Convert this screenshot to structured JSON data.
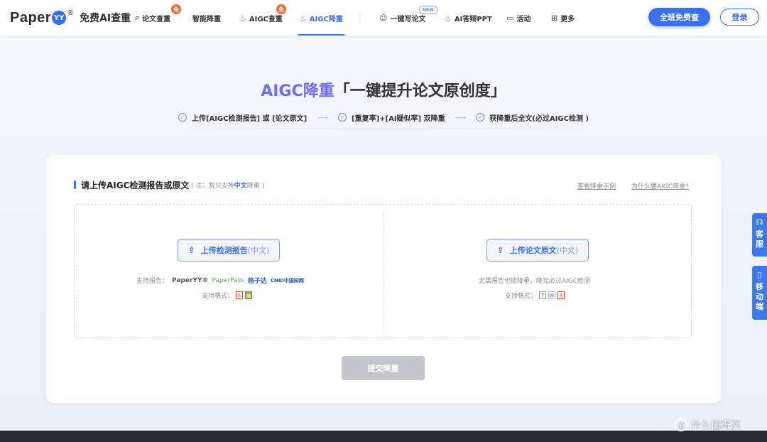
{
  "brand": {
    "logo_text": "Paper",
    "logo_mark": "YY",
    "logo_reg": "®",
    "slogan": "免费AI查重"
  },
  "nav": {
    "items": [
      {
        "label": "论文查重",
        "icon": "document-search-icon",
        "badge": "免"
      },
      {
        "label": "智能降重"
      },
      {
        "label": "AIGC查重",
        "icon": "fire-icon",
        "badge": "免"
      },
      {
        "label": "AIGC降重",
        "icon": "fire-icon",
        "active": true
      },
      {
        "label": "一键写论文",
        "icon": "brain-icon",
        "badge": "NEW"
      },
      {
        "label": "AI答辩PPT",
        "icon": "fire-icon"
      },
      {
        "label": "活动",
        "icon": "calendar-icon"
      },
      {
        "label": "更多",
        "icon": "grid-icon"
      }
    ],
    "cta_label": "全班免费查",
    "login_label": "登录"
  },
  "hero": {
    "title_highlight": "AIGC降重",
    "title_rest": "「一键提升论文原创度」",
    "steps": [
      "上传[AIGC检测报告] 或 [论文原文]",
      "[重复率]+[AI疑似率] 双降重",
      "获降重后全文(必过AIGC检测 )"
    ]
  },
  "card": {
    "title": "请上传AIGC检测报告或原文",
    "note_prefix": "( 注：暂只支持",
    "note_highlight": "中文",
    "note_suffix": "降重 )",
    "link_example": "查看降重示例",
    "link_why": "为什么要AIGC降重?",
    "left": {
      "button_label": "上传检测报告",
      "button_sub": "(中文)",
      "support_reports_label": "支持报告：",
      "support_reports": [
        "PaperYY®",
        "PaperPass",
        "格子达",
        "CNKI中国知网"
      ],
      "support_formats_label": "支持格式：",
      "formats": [
        "pdf",
        "zip"
      ]
    },
    "right": {
      "button_label": "上传论文原文",
      "button_sub": "(中文)",
      "hint": "无需报告也能降重，降完必过AIGC检测",
      "support_formats_label": "支持格式：",
      "formats": [
        "txt",
        "doc",
        "pdf"
      ]
    },
    "submit_label": "提交降重"
  },
  "side": {
    "service": "客服",
    "mobile": "移动端"
  },
  "watermark": "什么值得买"
}
